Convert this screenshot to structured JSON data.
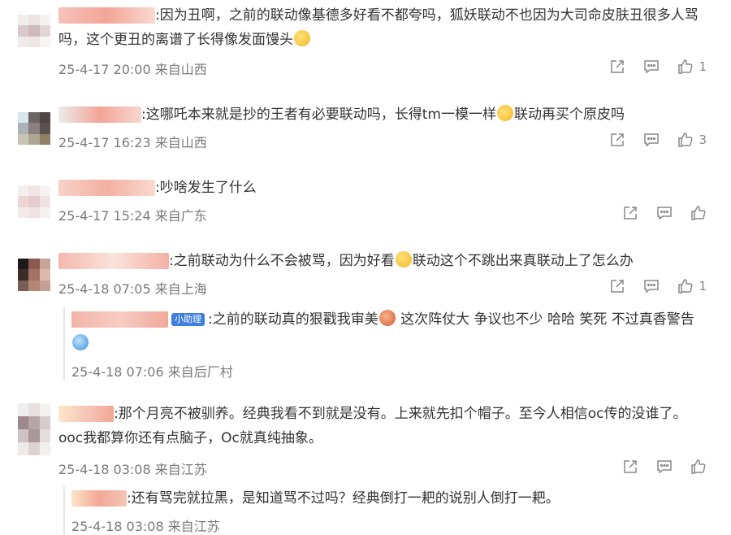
{
  "comments": [
    {
      "text": ":因为丑啊，之前的联动像基德多好看不都夸吗，狐妖联动不也因为大司命皮肤丑很多人骂吗，这个更丑的离谱了长得像发面馒头",
      "meta": "25-4-17 20:00 来自山西",
      "likes": "1"
    },
    {
      "text_a": ":这哪吒本来就是抄的王者有必要联动吗，长得tm一模一样",
      "text_b": "联动再买个原皮吗",
      "meta": "25-4-17 16:23 来自山西",
      "likes": "3"
    },
    {
      "text": ":吵啥发生了什么",
      "meta": "25-4-17 15:24 来自广东",
      "likes": ""
    },
    {
      "text_a": ":之前联动为什么不会被骂，因为好看",
      "text_b": "联动这个不跳出来真联动上了怎么办",
      "meta": "25-4-18 07:05 来自上海",
      "likes": "1"
    },
    {
      "text": ":那个月亮不被驯养。经典我看不到就是没有。上来就先扣个帽子。至今人相信oc传的没谁了。ooc我都算你还有点脑子，Oc就真纯抽象。",
      "meta": "25-4-18 03:08 来自江苏",
      "likes": ""
    }
  ],
  "replies": [
    {
      "badge": "小助理",
      "text_a": ":之前的联动真的狠戳我审美",
      "text_b": " 这次阵仗大 争议也不少 哈哈 笑死 不过真香警告",
      "meta": "25-4-18 07:06 来自后厂村"
    },
    {
      "text": ":还有骂完就拉黑，是知道骂不过吗？经典倒打一耙的说别人倒打一耙。",
      "meta": "25-4-18 03:08 来自江苏"
    }
  ]
}
